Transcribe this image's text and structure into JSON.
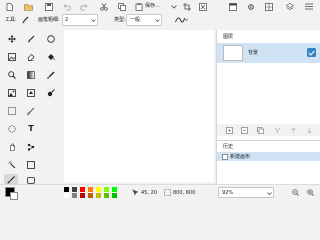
{
  "toolbar": {
    "open_label": "打开",
    "edit_menu_label": "保存...",
    "icons": [
      "document-icon",
      "folder-icon",
      "save-icon",
      "undo-icon",
      "redo-icon",
      "cut-icon",
      "copy-icon",
      "paste-icon",
      "crop-icon",
      "delete-icon",
      "window-icon",
      "settings-icon",
      "grid-icon"
    ]
  },
  "options": {
    "tool_label": "工具:",
    "brush_width_label": "画笔粗细:",
    "brush_width_value": "2",
    "type_label": "类型:",
    "type_value": "一般",
    "curve_icon": "curve-line-icon"
  },
  "tools": [
    "move-selection-icon",
    "pencil-icon",
    "ellipse-select-icon",
    "text-icon",
    "eraser-icon",
    "paint-bucket-icon",
    "zoom-icon",
    "gradient-icon",
    "color-picker-icon",
    "image-icon",
    "stamp-icon",
    "rect-select-icon",
    "lasso-icon",
    "pan-icon",
    "clone-icon",
    "magic-wand-icon",
    "rectangle-icon",
    "brush-icon",
    "rounded-rect-icon"
  ],
  "tools_visible_text": {
    "text_tool_glyph": "T"
  },
  "layers": {
    "header": "图层",
    "items": [
      {
        "name": "背景",
        "visible": true,
        "selected": true
      }
    ],
    "accent": "#3b82c4"
  },
  "history": {
    "header": "历史",
    "items": [
      {
        "label": "新建画布"
      }
    ]
  },
  "status": {
    "primary_color": "#000000",
    "secondary_color": "#ffffff",
    "cursor_pos": "45, 20",
    "selection_size": "800, 600",
    "zoom": "92%",
    "palette": [
      "#000000",
      "#404040",
      "#ff0000",
      "#ff8000",
      "#ffff00",
      "#80ff00",
      "#00ff00",
      "#ffffff",
      "#808080",
      "#c00000",
      "#c06000",
      "#c0c000",
      "#60c000",
      "#00c000"
    ]
  }
}
